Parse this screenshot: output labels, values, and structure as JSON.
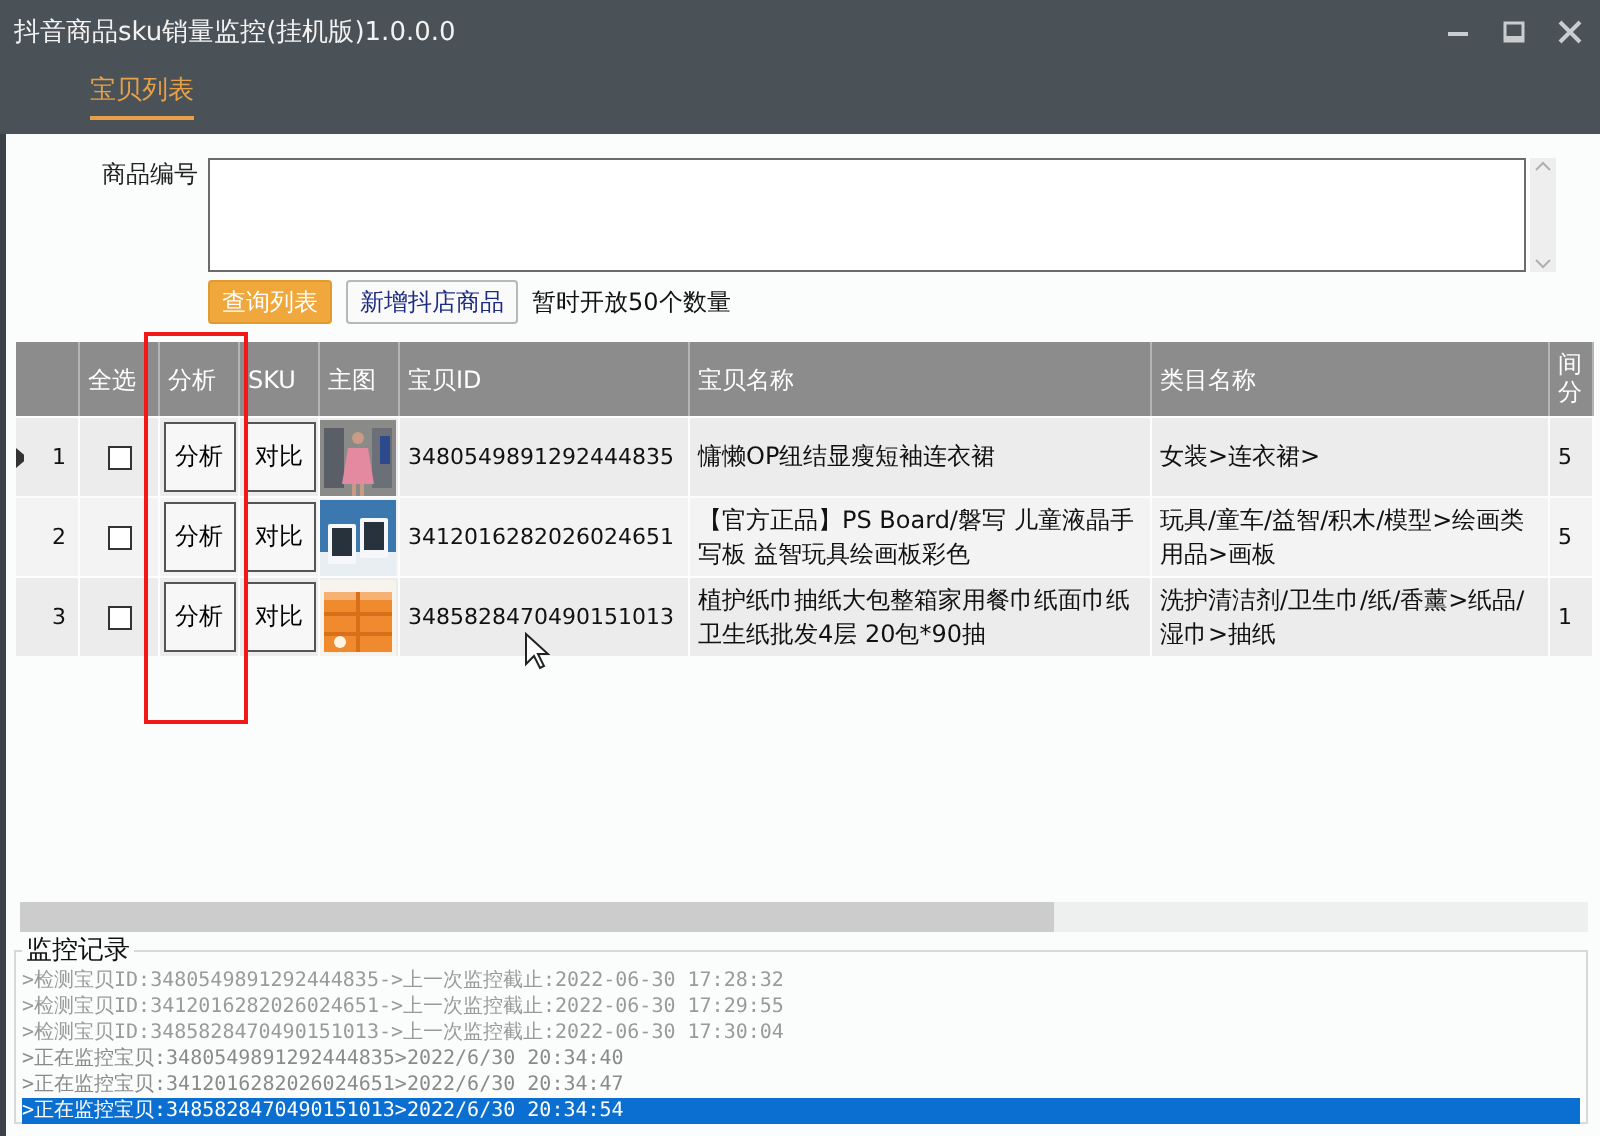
{
  "window": {
    "title": "抖音商品sku销量监控(挂机版)1.0.0.0"
  },
  "tabs": [
    {
      "label": "宝贝列表",
      "selected": true
    }
  ],
  "form": {
    "label": "商品编号",
    "buttons": [
      {
        "label": "查询列表",
        "kind": "primary"
      },
      {
        "label": "新增抖店商品",
        "kind": "default"
      }
    ],
    "note": "暂时开放50个数量"
  },
  "table": {
    "columns": [
      "全选",
      "分析",
      "SKU",
      "主图",
      "宝贝ID",
      "宝贝名称",
      "类目名称",
      "间分"
    ],
    "rows": [
      {
        "number": "1",
        "current": true,
        "checked": false,
        "analyze": "分析",
        "compare": "对比",
        "id": "3480549891292444835",
        "name": "慵懒OP纽结显瘦短袖连衣裙",
        "category": "女装>连衣裙>",
        "interval": "5"
      },
      {
        "number": "2",
        "current": false,
        "checked": false,
        "analyze": "分析",
        "compare": "对比",
        "id": "3412016282026024651",
        "name": "【官方正品】PS Board/磐写 儿童液晶手写板 益智玩具绘画板彩色",
        "category": "玩具/童车/益智/积木/模型>绘画类用品>画板",
        "interval": "5"
      },
      {
        "number": "3",
        "current": false,
        "checked": false,
        "analyze": "分析",
        "compare": "对比",
        "id": "3485828470490151013",
        "name": "植护纸巾抽纸大包整箱家用餐巾纸面巾纸卫生纸批发4层 20包*90抽",
        "category": "洗护清洁剂/卫生巾/纸/香薰>纸品/湿巾>抽纸",
        "interval": "1"
      }
    ]
  },
  "log": {
    "title": "监控记录",
    "entries": [
      {
        "text": ">检测宝贝ID:3480549891292444835->上一次监控截止:2022-06-30 17:28:32",
        "kind": "check",
        "selected": false
      },
      {
        "text": ">检测宝贝ID:3412016282026024651->上一次监控截止:2022-06-30 17:29:55",
        "kind": "check",
        "selected": false
      },
      {
        "text": ">检测宝贝ID:3485828470490151013->上一次监控截止:2022-06-30 17:30:04",
        "kind": "check",
        "selected": false
      },
      {
        "text": ">正在监控宝贝:3480549891292444835>2022/6/30 20:34:40",
        "kind": "monitor",
        "selected": false
      },
      {
        "text": ">正在监控宝贝:3412016282026024651>2022/6/30 20:34:47",
        "kind": "monitor",
        "selected": false
      },
      {
        "text": ">正在监控宝贝:3485828470490151013>2022/6/30 20:34:54",
        "kind": "monitor",
        "selected": true
      }
    ]
  }
}
